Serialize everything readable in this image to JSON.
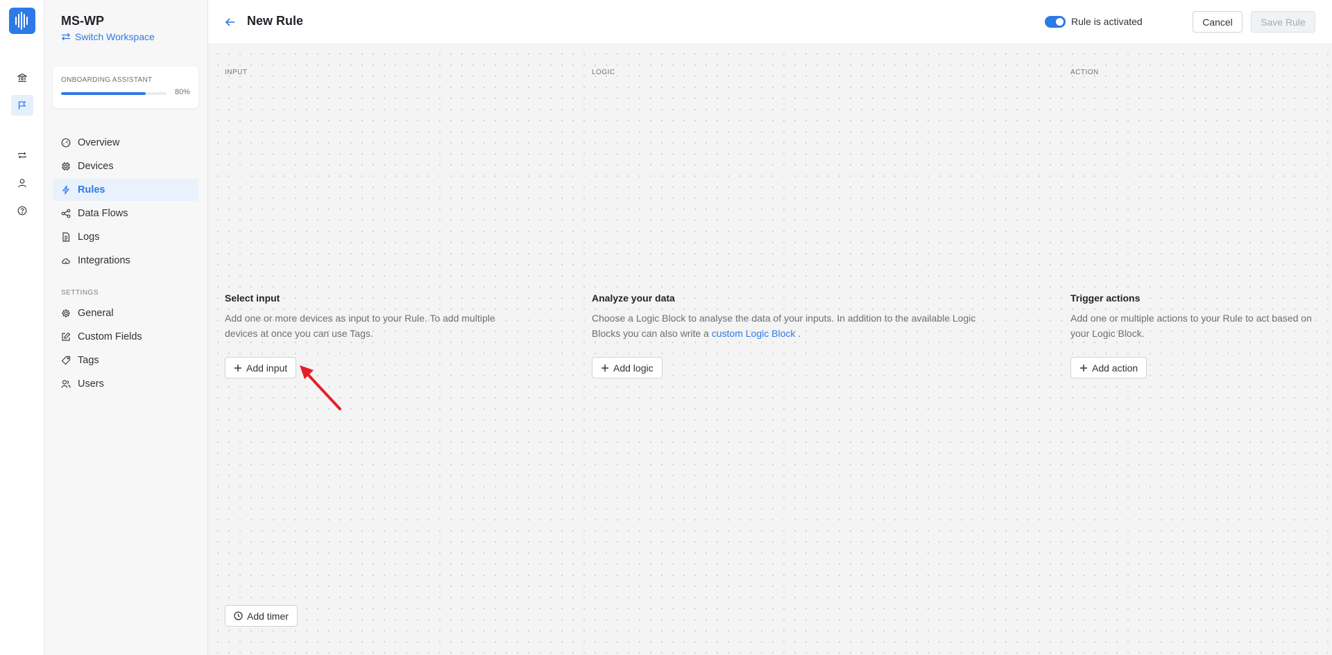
{
  "workspace": {
    "name": "MS-WP",
    "switch_label": "Switch Workspace"
  },
  "onboarding": {
    "label": "ONBOARDING ASSISTANT",
    "progress_percent": 80,
    "progress_text": "80%"
  },
  "nav": {
    "items": [
      {
        "label": "Overview",
        "icon": "gauge-icon"
      },
      {
        "label": "Devices",
        "icon": "chip-icon"
      },
      {
        "label": "Rules",
        "icon": "lightning-icon",
        "active": true
      },
      {
        "label": "Data Flows",
        "icon": "share-nodes-icon"
      },
      {
        "label": "Logs",
        "icon": "log-file-icon"
      },
      {
        "label": "Integrations",
        "icon": "cloud-icon"
      }
    ],
    "settings_label": "SETTINGS",
    "settings_items": [
      {
        "label": "General",
        "icon": "gear-icon"
      },
      {
        "label": "Custom Fields",
        "icon": "edit-icon"
      },
      {
        "label": "Tags",
        "icon": "tag-icon"
      },
      {
        "label": "Users",
        "icon": "users-icon"
      }
    ]
  },
  "rail": {
    "icons": [
      "bank-icon",
      "flag-icon",
      "repeat-icon",
      "user-icon",
      "help-icon"
    ]
  },
  "header": {
    "title": "New Rule",
    "toggle_label": "Rule is activated",
    "toggle_on": true,
    "cancel_label": "Cancel",
    "save_label": "Save Rule"
  },
  "columns": {
    "input": {
      "label": "INPUT",
      "title": "Select input",
      "desc_line1": "Add one or more devices as input to your Rule. To add multiple",
      "desc_line2": "devices at once you can use Tags.",
      "button": "Add input"
    },
    "logic": {
      "label": "LOGIC",
      "title": "Analyze your data",
      "desc_line1": "Choose a Logic Block to analyse the data of your inputs. In addition to the available Logic",
      "desc_line2_prefix": "Blocks you can also write a",
      "desc_link": "custom Logic Block",
      "desc_line2_suffix": ".",
      "button": "Add logic"
    },
    "action": {
      "label": "ACTION",
      "title": "Trigger actions",
      "desc_line1": "Add one or multiple actions to your Rule to act based on",
      "desc_line2": "your Logic Block.",
      "button": "Add action"
    }
  },
  "timer_button": "Add timer",
  "colors": {
    "accent": "#2d7ae6",
    "annotation_arrow": "#e3202a"
  }
}
